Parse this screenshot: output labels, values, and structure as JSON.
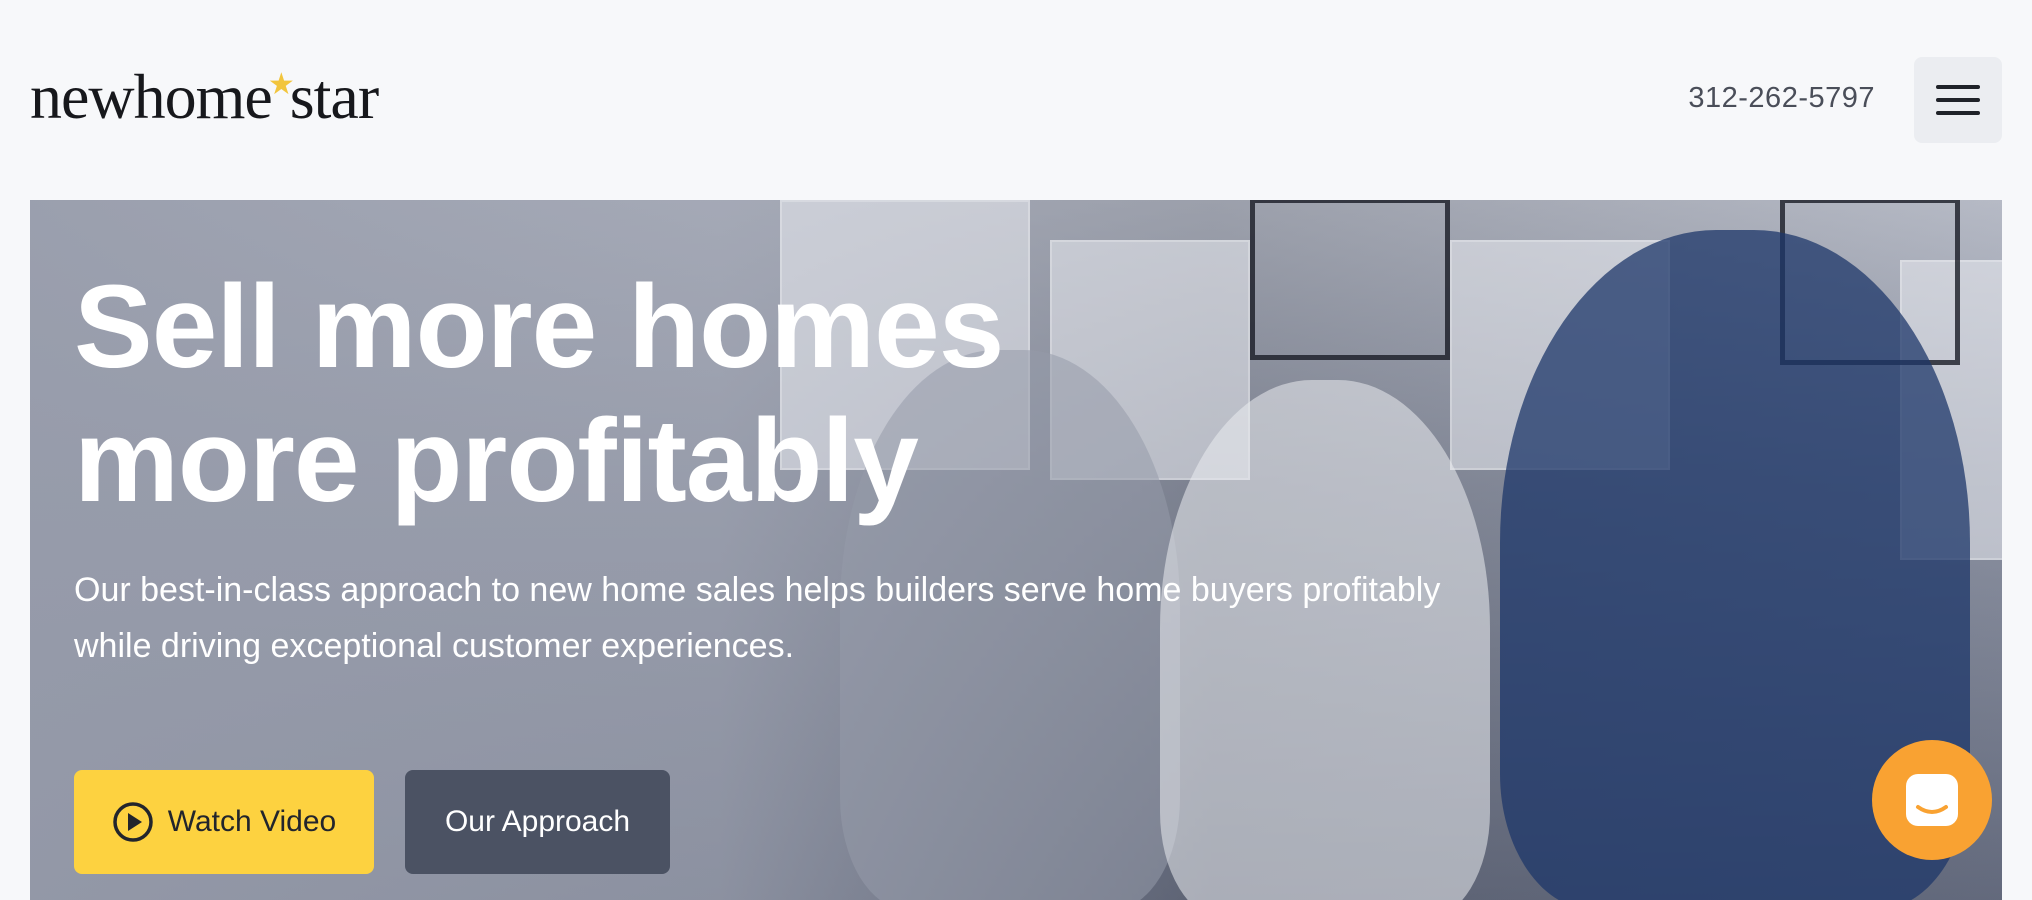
{
  "header": {
    "logo_part1": "newhome",
    "logo_part2": "star",
    "phone": "312-262-5797"
  },
  "hero": {
    "title": "Sell more homes\nmore profitably",
    "subtitle": "Our best-in-class approach to new home sales helps builders serve home buyers profitably while driving exceptional customer experiences.",
    "buttons": {
      "watch_video": "Watch Video",
      "our_approach": "Our Approach"
    }
  },
  "icons": {
    "menu": "hamburger-menu-icon",
    "play": "play-circle-icon",
    "chat": "chat-messenger-icon",
    "logo_star": "star-icon"
  },
  "colors": {
    "accent_yellow": "#fdd240",
    "button_dark": "#4b5263",
    "chat_orange": "#f9a232",
    "logo_star": "#f2c53d"
  }
}
